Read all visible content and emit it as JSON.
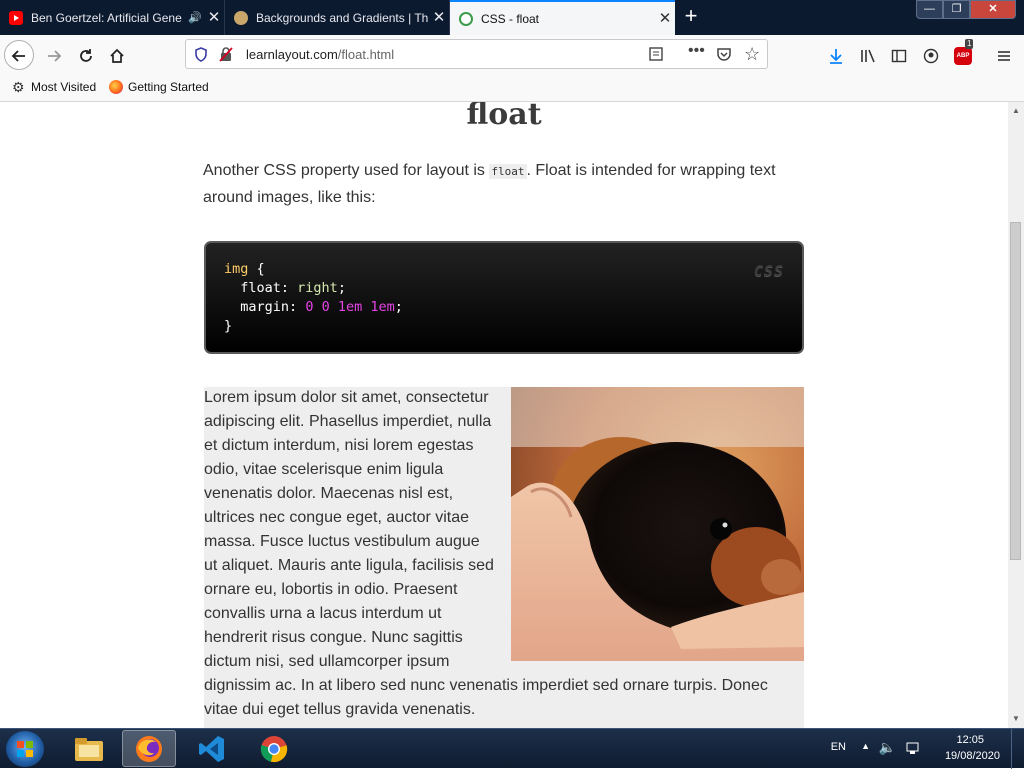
{
  "tabs": [
    {
      "title": "Ben Goertzel: Artificial Gene",
      "audio": "🔊",
      "close": "✕",
      "state": "inactive",
      "favicon": "youtube-icon"
    },
    {
      "title": "Backgrounds and Gradients | Th",
      "close": "✕",
      "state": "inactive",
      "favicon": "site-icon"
    },
    {
      "title": "CSS - float",
      "close": "✕",
      "state": "active",
      "favicon": "layout-icon"
    }
  ],
  "new_tab": "+",
  "window_controls": {
    "minimize": "—",
    "maximize": "❐",
    "close": "✕"
  },
  "url": {
    "host": "learnlayout.com",
    "path": "/float.html"
  },
  "bookmarks": [
    {
      "label": "Most Visited",
      "icon": "gear-icon"
    },
    {
      "label": "Getting Started",
      "icon": "firefox-icon"
    }
  ],
  "addon_badge": "1",
  "addon_label": "ABP",
  "page": {
    "heading": "float",
    "intro_before": "Another CSS property used for layout is ",
    "intro_code": "float",
    "intro_after": ". Float is intended for wrapping text around images, like this:",
    "code_lang": "CSS",
    "code_selector": "img",
    "code_brace_open": "{",
    "code_brace_close": "}",
    "code_prop1": "float",
    "code_val1": "right",
    "code_prop2": "margin",
    "code_val2": "0 0 1em 1em",
    "lorem": "Lorem ipsum dolor sit amet, consectetur adipiscing elit. Phasellus imperdiet, nulla et dictum interdum, nisi lorem egestas odio, vitae scelerisque enim ligula venenatis dolor. Maecenas nisl est, ultrices nec congue eget, auctor vitae massa. Fusce luctus vestibulum augue ut aliquet. Mauris ante ligula, facilisis sed ornare eu, lobortis in odio. Praesent convallis urna a lacus interdum ut hendrerit risus congue. Nunc sagittis dictum nisi, sed ullamcorper ipsum dignissim ac. In at libero sed nunc venenatis imperdiet sed ornare turpis. Donec vitae dui eget tellus gravida venenatis."
  },
  "taskbar": {
    "language": "EN",
    "time": "12:05",
    "date": "19/08/2020",
    "apps": [
      "explorer-icon",
      "firefox-icon",
      "vscode-icon",
      "chrome-icon"
    ]
  },
  "colors": {
    "accent": "#0a84ff",
    "code_selector": "#ffcc66",
    "code_value": "#d5e8b0",
    "code_number": "#e544e5"
  }
}
